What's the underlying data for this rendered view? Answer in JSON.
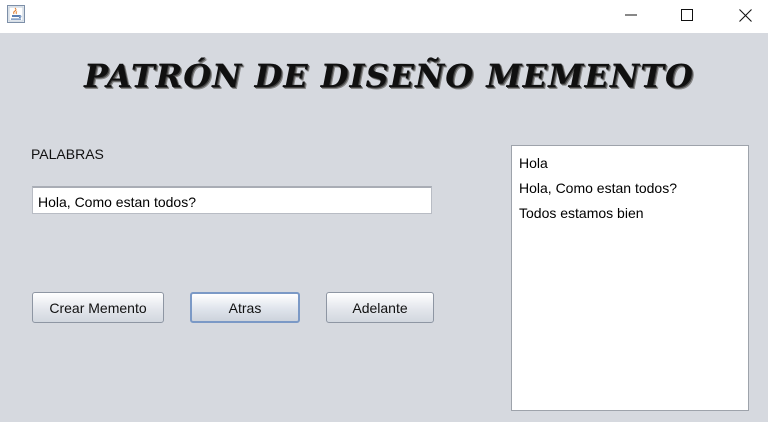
{
  "window": {
    "app_icon": "java-icon",
    "controls": {
      "minimize_icon": "minimize-icon",
      "maximize_icon": "maximize-icon",
      "close_icon": "close-icon"
    }
  },
  "header": {
    "title": "PATRÓN DE DISEÑO MEMENTO"
  },
  "form": {
    "palabras_label": "PALABRAS",
    "input_value": "Hola, Como estan todos?"
  },
  "buttons": {
    "crear_label": "Crear Memento",
    "atras_label": "Atras",
    "adelante_label": "Adelante"
  },
  "list": {
    "items": [
      {
        "label": "Hola"
      },
      {
        "label": "Hola, Como estan todos?"
      },
      {
        "label": "Todos estamos bien"
      }
    ]
  }
}
